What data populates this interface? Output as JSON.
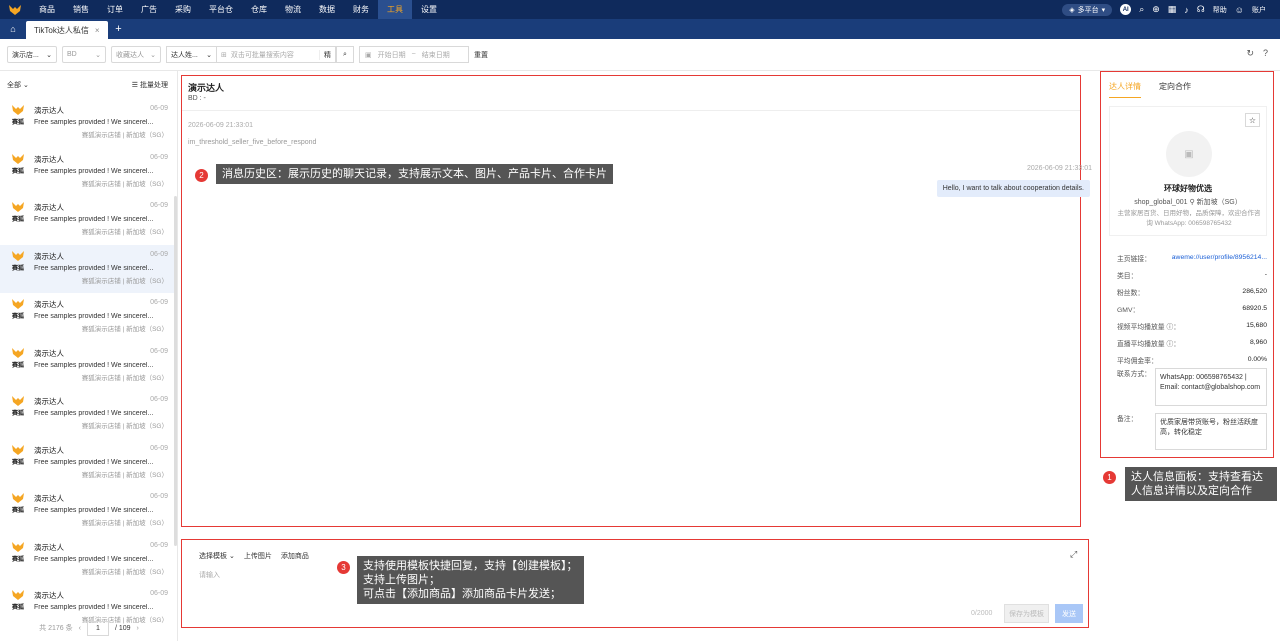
{
  "nav": {
    "items": [
      "商品",
      "销售",
      "订单",
      "广告",
      "采购",
      "平台仓",
      "仓库",
      "物流",
      "数据",
      "财务",
      "工具",
      "设置"
    ],
    "active_index": 10,
    "platform": "多平台",
    "ai": "AI",
    "help": "帮助",
    "account": "账户"
  },
  "tabs": {
    "active": "TikTok达人私信"
  },
  "filters": {
    "shop": "演示店...",
    "bd": "BD",
    "favorites": "收藏达人",
    "creator": "达人姓...",
    "search_placeholder": "双击可批量搜索内容",
    "search_btn": "精",
    "date_start": "开始日期",
    "date_sep": "~",
    "date_end": "结束日期",
    "reset": "重置"
  },
  "left": {
    "filter_all": "全部",
    "batch": "批量处理",
    "conversations": [
      {
        "name": "演示达人",
        "date": "06-09",
        "msg": "Free samples provided ! We sincerel...",
        "store": "赛狐演示店铺 | 新加坡（SG）",
        "avatar_text": "赛狐"
      },
      {
        "name": "演示达人",
        "date": "06-09",
        "msg": "Free samples provided ! We sincerel...",
        "store": "赛狐演示店铺 | 新加坡（SG）",
        "avatar_text": "赛狐"
      },
      {
        "name": "演示达人",
        "date": "06-09",
        "msg": "Free samples provided ! We sincerel...",
        "store": "赛狐演示店铺 | 新加坡（SG）",
        "avatar_text": "赛狐"
      },
      {
        "name": "演示达人",
        "date": "06-09",
        "msg": "Free samples provided ! We sincerel...",
        "store": "赛狐演示店铺 | 新加坡（SG）",
        "avatar_text": "赛狐"
      },
      {
        "name": "演示达人",
        "date": "06-09",
        "msg": "Free samples provided ! We sincerel...",
        "store": "赛狐演示店铺 | 新加坡（SG）",
        "avatar_text": "赛狐"
      },
      {
        "name": "演示达人",
        "date": "06-09",
        "msg": "Free samples provided ! We sincerel...",
        "store": "赛狐演示店铺 | 新加坡（SG）",
        "avatar_text": "赛狐"
      },
      {
        "name": "演示达人",
        "date": "06-09",
        "msg": "Free samples provided ! We sincerel...",
        "store": "赛狐演示店铺 | 新加坡（SG）",
        "avatar_text": "赛狐"
      },
      {
        "name": "演示达人",
        "date": "06-09",
        "msg": "Free samples provided ! We sincerel...",
        "store": "赛狐演示店铺 | 新加坡（SG）",
        "avatar_text": "赛狐"
      },
      {
        "name": "演示达人",
        "date": "06-09",
        "msg": "Free samples provided ! We sincerel...",
        "store": "赛狐演示店铺 | 新加坡（SG）",
        "avatar_text": "赛狐"
      },
      {
        "name": "演示达人",
        "date": "06-09",
        "msg": "Free samples provided ! We sincerel...",
        "store": "赛狐演示店铺 | 新加坡（SG）",
        "avatar_text": "赛狐"
      },
      {
        "name": "演示达人",
        "date": "06-09",
        "msg": "Free samples provided ! We sincerel...",
        "store": "赛狐演示店铺 | 新加坡（SG）",
        "avatar_text": "赛狐"
      }
    ],
    "selected_index": 3,
    "pager": {
      "total": "共 2176 条",
      "page": "1",
      "pages": "/ 109"
    }
  },
  "chat": {
    "title": "演示达人",
    "bd": "BD : -",
    "msg1_time": "2026-06-09 21:33:01",
    "msg1_text": "im_threshold_seller_five_before_respond",
    "msg2_time": "2026-06-09 21:33:01",
    "msg2_text": "Hello, I want to talk about cooperation details."
  },
  "tips": {
    "t1_num": "1",
    "t1_line1": "达人信息面板：支持查看达",
    "t1_line2": "人信息详情以及定向合作",
    "t2_num": "2",
    "t2": "消息历史区：展示历史的聊天记录，支持展示文本、图片、产品卡片、合作卡片",
    "t3_num": "3",
    "t3_line1": "支持使用模板快捷回复，支持【创建模板】；",
    "t3_line2": "支持上传图片；",
    "t3_line3": "可点击【添加商品】添加商品卡片发送；"
  },
  "composer": {
    "template": "选择模板",
    "upload": "上传图片",
    "add_product": "添加商品",
    "placeholder": "请输入",
    "count": "0/2000",
    "save_template": "保存为模板",
    "send": "发送"
  },
  "right": {
    "tab_detail": "达人详情",
    "tab_coop": "定向合作",
    "name": "环球好物优选",
    "handle": "shop_global_001",
    "location": "新加坡（SG）",
    "desc_line1": "主营家居百货、日用好物，品质保障，欢迎合作咨",
    "desc_line2": "询 WhatsApp: 006598765432",
    "rows": [
      {
        "k": "主页链接：",
        "v": "aweme://user/profile/8956214..."
      },
      {
        "k": "类目：",
        "v": "-"
      },
      {
        "k": "粉丝数：",
        "v": "286,520"
      },
      {
        "k": "GMV：",
        "v": "68920.5"
      },
      {
        "k": "视频平均播放量 ⓘ：",
        "v": "15,680"
      },
      {
        "k": "直播平均播放量 ⓘ：",
        "v": "8,960"
      },
      {
        "k": "平均佣金率：",
        "v": "0.00%"
      }
    ],
    "contact_label": "联系方式：",
    "contact": "WhatsApp: 006598765432 | Email: contact@globalshop.com",
    "note_label": "备注：",
    "note": "优质家居带货账号，粉丝活跃度高，转化稳定"
  }
}
